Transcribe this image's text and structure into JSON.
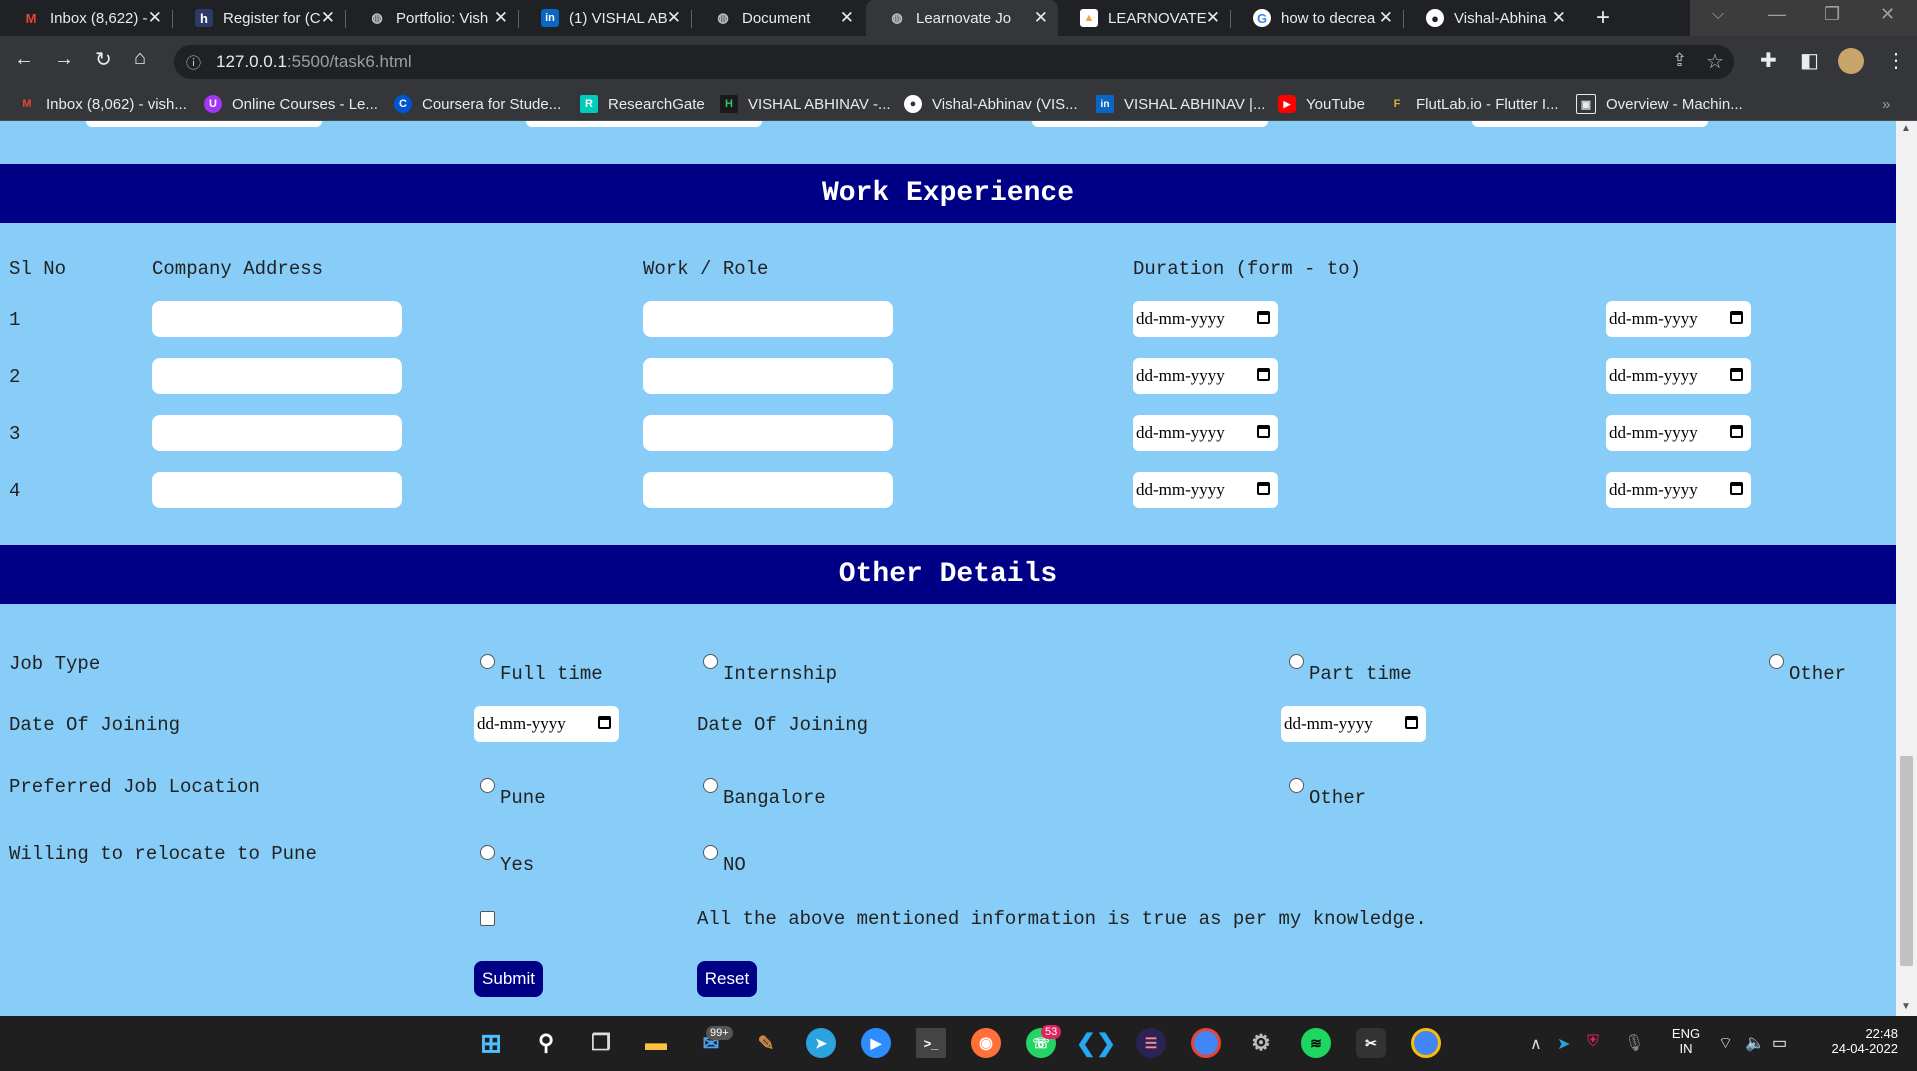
{
  "browser": {
    "tabs": [
      {
        "label": "Inbox (8,622) -",
        "icon": "gmail-icon",
        "glyph": "M",
        "color": "#ea4335"
      },
      {
        "label": "Register for (C",
        "icon": "page-icon",
        "glyph": "h",
        "color": "#2d3a66"
      },
      {
        "label": "Portfolio: Vish",
        "icon": "globe-icon",
        "glyph": "◍",
        "color": "#5f6368"
      },
      {
        "label": "(1) VISHAL AB",
        "icon": "linkedin-icon",
        "glyph": "in",
        "color": "#0a66c2"
      },
      {
        "label": "Document",
        "icon": "globe-icon",
        "glyph": "◍",
        "color": "#5f6368"
      },
      {
        "label": "Learnovate Jo",
        "icon": "globe-icon",
        "glyph": "◍",
        "color": "#5f6368"
      },
      {
        "label": "LEARNOVATE",
        "icon": "learnovate-icon",
        "glyph": "▲",
        "color": "#f4a340"
      },
      {
        "label": "how to decrea",
        "icon": "google-icon",
        "glyph": "G",
        "color": "#4285f4"
      },
      {
        "label": "Vishal-Abhina",
        "icon": "github-icon",
        "glyph": "●",
        "color": "#ffffff"
      }
    ],
    "url": "127.0.0.1:5500/task6.html",
    "url_host": "127.0.0.1",
    "url_rest": ":5500/task6.html",
    "new_tab": "+",
    "bookmarks": [
      {
        "label": "Inbox (8,062) - vish...",
        "icon": "gmail-icon",
        "glyph": "M",
        "color": "#ea4335"
      },
      {
        "label": "Online Courses - Le...",
        "icon": "udemy-icon",
        "glyph": "U",
        "color": "#a435f0"
      },
      {
        "label": "Coursera for Stude...",
        "icon": "coursera-icon",
        "glyph": "C",
        "color": "#0056d2"
      },
      {
        "label": "ResearchGate",
        "icon": "researchgate-icon",
        "glyph": "R",
        "color": "#00ccbb"
      },
      {
        "label": "VISHAL ABHINAV -...",
        "icon": "hackerrank-icon",
        "glyph": "H",
        "color": "#2ec866"
      },
      {
        "label": "Vishal-Abhinav (VIS...",
        "icon": "github-icon",
        "glyph": "●",
        "color": "#333333"
      },
      {
        "label": "VISHAL ABHINAV |...",
        "icon": "linkedin-icon",
        "glyph": "in",
        "color": "#0a66c2"
      },
      {
        "label": "YouTube",
        "icon": "youtube-icon",
        "glyph": "▶",
        "color": "#ff0000"
      },
      {
        "label": "FlutLab.io - Flutter I...",
        "icon": "flutlab-icon",
        "glyph": "F",
        "color": "#d4b23a"
      },
      {
        "label": "Overview - Machin...",
        "icon": "overview-icon",
        "glyph": "▣",
        "color": "#5f6368"
      }
    ],
    "more_bookmarks": "»"
  },
  "page": {
    "work_experience": {
      "title": "Work Experience",
      "headers": [
        "Sl No",
        "Company Address",
        "Work / Role",
        "Duration (form - to)"
      ],
      "rows": [
        "1",
        "2",
        "3",
        "4"
      ],
      "date_placeholder": "dd-mm-yyyy"
    },
    "other_details": {
      "title": "Other Details",
      "job_type": {
        "label": "Job Type",
        "options": [
          "Full time",
          "Internship",
          "Part time",
          "Other"
        ]
      },
      "date_of_joining": {
        "label": "Date Of Joining",
        "label2": "Date Of Joining",
        "placeholder": "dd-mm-yyyy"
      },
      "location": {
        "label": "Preferred Job Location",
        "options": [
          "Pune",
          "Bangalore",
          "Other"
        ]
      },
      "relocate": {
        "label": "Willing to relocate to Pune",
        "options": [
          "Yes",
          "NO"
        ]
      },
      "declaration": "All the above mentioned information is true as per my knowledge.",
      "submit": "Submit",
      "reset": "Reset"
    }
  },
  "taskbar": {
    "mail_badge": "99+",
    "whatsapp_badge": "53",
    "lang": "ENG",
    "region": "IN",
    "time": "22:48",
    "date": "24-04-2022"
  },
  "colors": {
    "page_bg": "#87cdf8",
    "band": "#000087",
    "button": "#000087"
  }
}
